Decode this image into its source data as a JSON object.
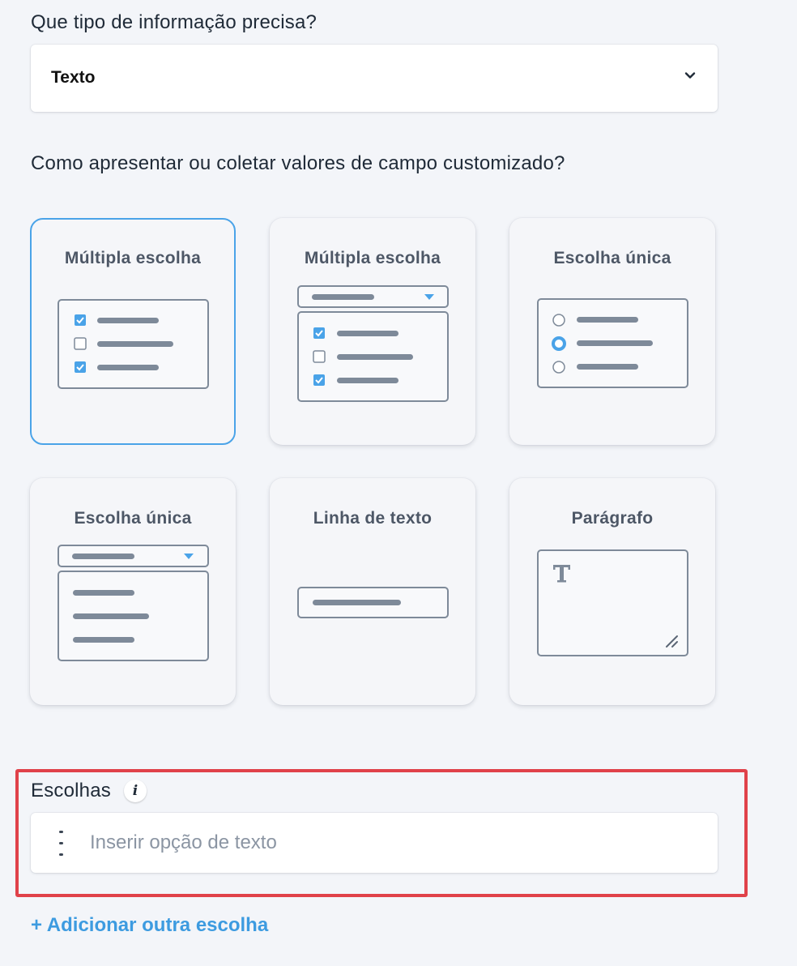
{
  "type_question": "Que tipo de informação precisa?",
  "type_select": {
    "value": "Texto"
  },
  "display_question": "Como apresentar ou coletar valores de campo customizado?",
  "options": [
    {
      "title": "Múltipla escolha",
      "selected": true,
      "icon": "checkbox-list-icon"
    },
    {
      "title": "Múltipla escolha",
      "selected": false,
      "icon": "checkbox-dropdown-icon"
    },
    {
      "title": "Escolha única",
      "selected": false,
      "icon": "radio-list-icon"
    },
    {
      "title": "Escolha única",
      "selected": false,
      "icon": "single-dropdown-icon"
    },
    {
      "title": "Linha de texto",
      "selected": false,
      "icon": "text-line-icon"
    },
    {
      "title": "Parágrafo",
      "selected": false,
      "icon": "paragraph-icon"
    }
  ],
  "choices": {
    "label": "Escolhas",
    "info_icon": "i",
    "placeholder": "Inserir opção de texto"
  },
  "add_choice_link": "+ Adicionar outra escolha",
  "colors": {
    "accent": "#4aa3e8",
    "highlight_border": "#e0424a",
    "link": "#3d9be0",
    "bar": "#7e8a99"
  }
}
